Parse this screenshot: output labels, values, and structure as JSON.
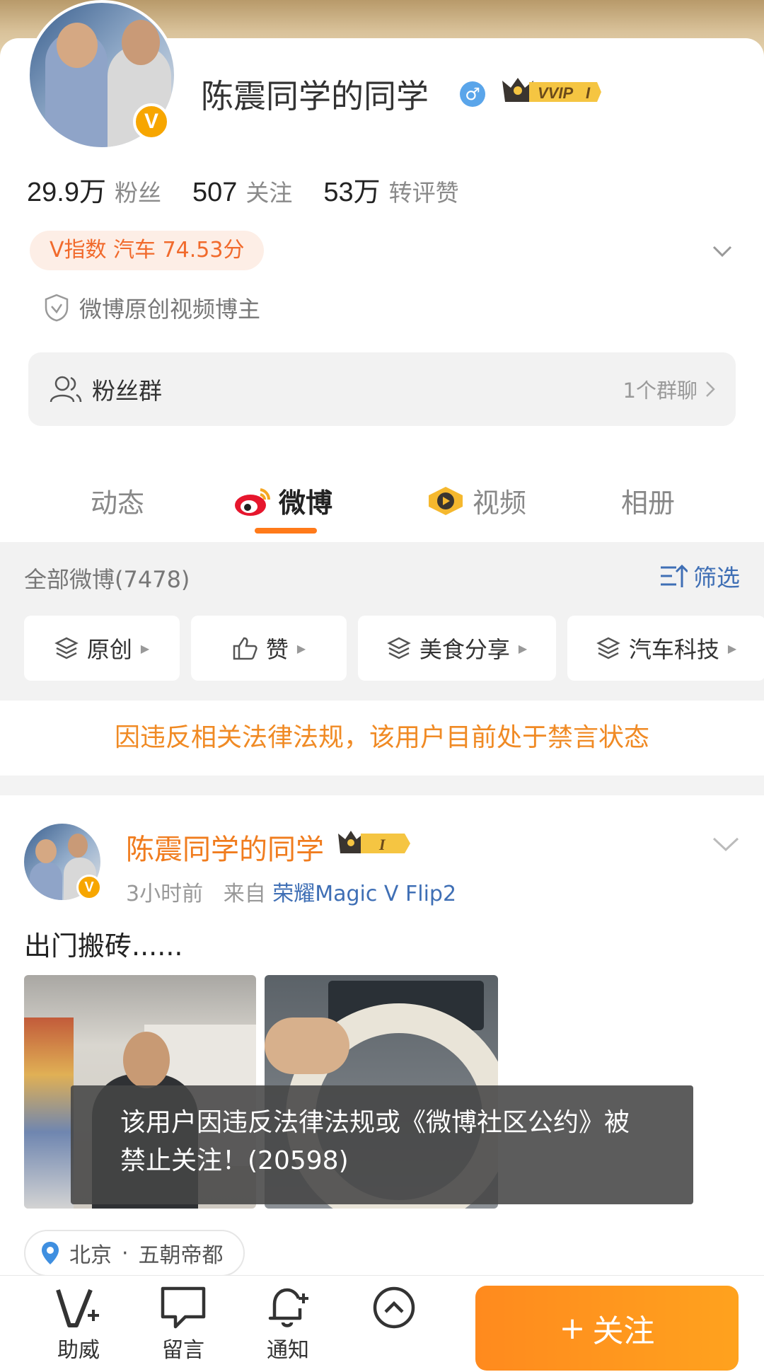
{
  "profile": {
    "name": "陈震同学的同学",
    "gender_symbol": "♂",
    "vip_label": "VVIP",
    "vip_level": "I",
    "verified_symbol": "V"
  },
  "stats": [
    {
      "num": "29.9万",
      "label": "粉丝"
    },
    {
      "num": "507",
      "label": "关注"
    },
    {
      "num": "53万",
      "label": "转评赞"
    }
  ],
  "vindex": "V指数 汽车 74.53分",
  "creator_label": "微博原创视频博主",
  "fans_group": {
    "label": "粉丝群",
    "count": "1个群聊"
  },
  "tabs": [
    {
      "label": "动态"
    },
    {
      "label": "微博"
    },
    {
      "label": "视频"
    },
    {
      "label": "相册"
    }
  ],
  "filter": {
    "all_label": "全部微博(7478)",
    "filter_label": "筛选",
    "chips": [
      {
        "label": "原创"
      },
      {
        "label": "赞"
      },
      {
        "label": "美食分享"
      },
      {
        "label": "汽车科技"
      }
    ]
  },
  "ban_notice": "因违反相关法律法规，该用户目前处于禁言状态",
  "post": {
    "author": "陈震同学的同学",
    "level": "I",
    "time": "3小时前",
    "from_label": "来自",
    "source": "荣耀Magic V Flip2",
    "text": "出门搬砖......",
    "location_city": "北京",
    "location_sep": "·",
    "location_name": "五朝帝都"
  },
  "toast": "该用户因违反法律法规或《微博社区公约》被禁止关注！(20598)",
  "bottom_bar": {
    "items": [
      {
        "label": "助威"
      },
      {
        "label": "留言"
      },
      {
        "label": "通知"
      },
      {
        "label": ""
      }
    ],
    "follow_label": "关注",
    "follow_plus": "+"
  },
  "colors": {
    "accent": "#ff7a1a",
    "link": "#3f6fb5",
    "ban_text": "#f08a24",
    "post_name": "#f07c1e"
  }
}
